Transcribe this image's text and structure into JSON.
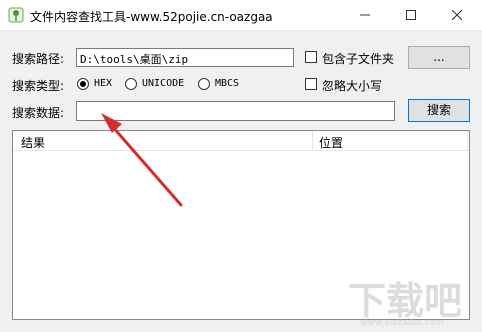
{
  "window": {
    "title": "文件内容查找工具-www.52pojie.cn-oazgaa",
    "minimize_icon": "minimize-icon",
    "maximize_icon": "maximize-icon",
    "close_icon": "close-icon"
  },
  "form": {
    "path_label": "搜索路径:",
    "path_value": "D:\\tools\\桌面\\zip",
    "include_subfolders_label": "包含子文件夹",
    "include_subfolders_checked": false,
    "browse_button": "...",
    "type_label": "搜索类型:",
    "types": [
      "HEX",
      "UNICODE",
      "MBCS"
    ],
    "selected_type": "HEX",
    "ignore_case_label": "忽略大小写",
    "ignore_case_checked": false,
    "data_label": "搜索数据:",
    "data_value": "",
    "search_button": "搜索"
  },
  "results": {
    "columns": [
      "结果",
      "位置"
    ],
    "rows": []
  },
  "watermark": {
    "text": "下载吧",
    "subtext": "www.xiazaiba.com"
  },
  "colors": {
    "arrow": "#d32f2f",
    "window_bg": "#f0f0f0",
    "focus_border": "#0078d7"
  }
}
